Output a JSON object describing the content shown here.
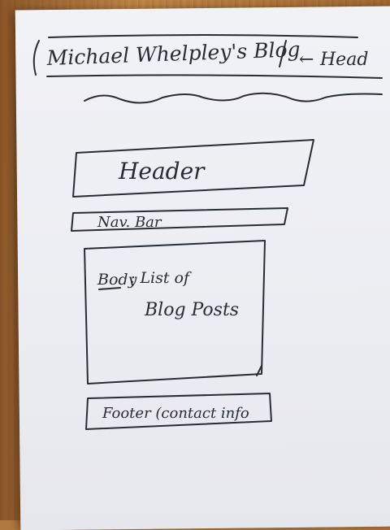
{
  "top_note": {
    "title": "Michael Whelpley's Blog",
    "arrow": "←",
    "arrow_label": "Head"
  },
  "wireframe": {
    "header": "Header",
    "nav": "Nav. Bar",
    "body_prefix": "Body",
    "body_line1": ": List of",
    "body_line2": "Blog Posts",
    "footer": "Footer (contact info"
  }
}
